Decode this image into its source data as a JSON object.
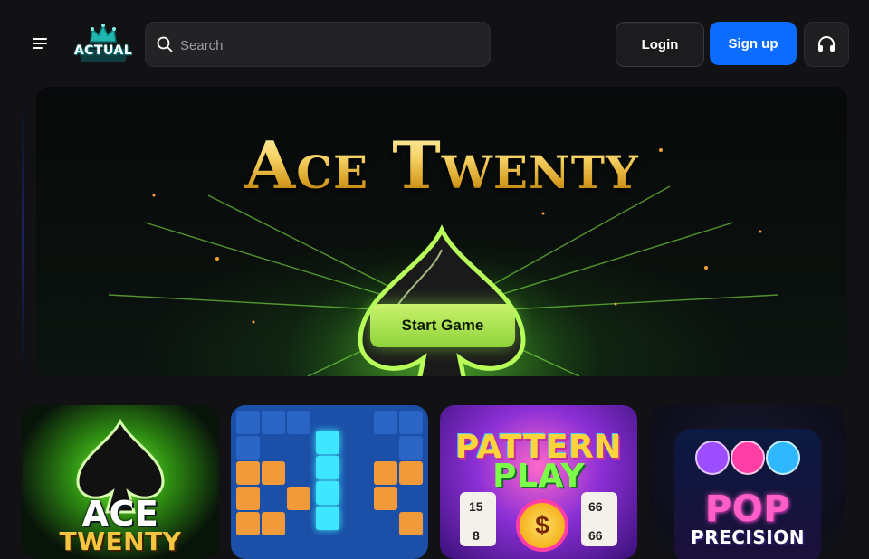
{
  "header": {
    "menu_icon": "hamburger-menu-icon",
    "logo_text": "ACTUAL",
    "search": {
      "placeholder": "Search",
      "icon": "search-icon"
    },
    "login_label": "Login",
    "signup_label": "Sign up",
    "support_icon": "headset-icon"
  },
  "hero": {
    "title": "Ace Twenty",
    "cta_label": "Start Game"
  },
  "games": [
    {
      "title_line1": "ACE",
      "title_line2": "TWENTY"
    },
    {
      "title_line1": "",
      "title_line2": ""
    },
    {
      "title_line1": "PATTERN",
      "title_line2": "PLAY"
    },
    {
      "title_line1": "POP",
      "title_line2": "PRECISION"
    }
  ],
  "tiles_misc": {
    "pattern_numbers": [
      "15",
      "66",
      "8",
      "66"
    ],
    "dollar": "$"
  },
  "colors": {
    "background": "#121214",
    "signup": "#0b6cff",
    "cta": "#a6e24a",
    "gold": "#f2c94c"
  }
}
